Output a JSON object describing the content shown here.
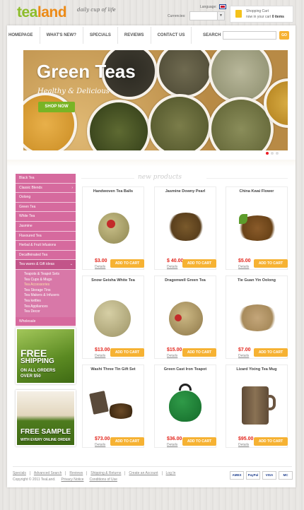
{
  "header": {
    "logo_tea": "tea",
    "logo_land": "land",
    "tagline": "daily cup of life",
    "language_label": "Language:",
    "currencies_label": "Currencies:",
    "currency_value": "",
    "cart_title": "Shopping Cart",
    "cart_status_prefix": "now in your cart",
    "cart_count": "0 items"
  },
  "nav": {
    "items": [
      "HOMEPAGE",
      "WHAT'S NEW?",
      "SPECIALS",
      "REVIEWS",
      "CONTACT US"
    ],
    "search_label": "SEARCH",
    "search_placeholder": "",
    "go_label": "GO"
  },
  "banner": {
    "headline": "Green Teas",
    "subhead": "Healthy & Delicious",
    "cta": "SHOP NOW"
  },
  "sidebar": {
    "categories": [
      {
        "label": "Black Tea"
      },
      {
        "label": "Classic Blends",
        "caret": "›"
      },
      {
        "label": "Oolong"
      },
      {
        "label": "Green Tea"
      },
      {
        "label": "White Tea"
      },
      {
        "label": "Jasmine"
      },
      {
        "label": "Flavoured Tea"
      },
      {
        "label": "Herbal & Fruit Infusions"
      },
      {
        "label": "Decaffeinated Tea"
      },
      {
        "label": "Tea wares & Gift ideas",
        "caret": "⌄"
      }
    ],
    "subcategories": [
      "Teapots & Teapot Sets",
      "Tea Cups & Mugs",
      "Tea Accessories",
      "Tea Storage Tins",
      "Tea Makers & Infusers",
      "Tea kettles",
      "Tea Appliances",
      "Tea Decor"
    ],
    "active_subcategory": "Tea Accessories",
    "last_category": "Wholesale"
  },
  "promos": {
    "shipping_big": "FREE",
    "shipping_big2": "SHIPPING",
    "shipping_small": "ON ALL ORDERS",
    "shipping_small2": "OVER $50",
    "sample_big": "FREE SAMPLE",
    "sample_small": "WITH EVERY ONLINE ORDER"
  },
  "products_title": "new products",
  "products": [
    {
      "name": "Handwoven Tea Balls",
      "price": "$3.00",
      "details": "Details",
      "add": "ADD TO CART"
    },
    {
      "name": "Jasmine Downy Pearl",
      "price": "$ 40.00",
      "details": "Details",
      "add": "ADD TO CART"
    },
    {
      "name": "China Kwai Flower",
      "price": "$5.00",
      "details": "Details",
      "add": "ADD TO CART"
    },
    {
      "name": "Snow Geisha White Tea",
      "price": "$13.00",
      "details": "Details",
      "add": "ADD TO CART"
    },
    {
      "name": "Dragonwell Green Tea",
      "price": "$15.00",
      "details": "Details",
      "add": "ADD TO CART"
    },
    {
      "name": "Tie Guan Yin Oolong",
      "price": "$7.00",
      "details": "Details",
      "add": "ADD TO CART"
    },
    {
      "name": "Washi Three Tin Gift Set",
      "price": "$73.00",
      "details": "Details",
      "add": "ADD TO CART"
    },
    {
      "name": "Green Cast Iron Teapot",
      "price": "$36.00",
      "details": "Details",
      "add": "ADD TO CART"
    },
    {
      "name": "Lizard Yixing Tea Mug",
      "price": "$95.00",
      "details": "Details",
      "add": "ADD TO CART"
    }
  ],
  "footer": {
    "links": [
      "Specials",
      "Advanced Search",
      "Reviews",
      "Shipping & Returns",
      "Create an Account",
      "Log In"
    ],
    "copyright": "Copyright © 2011 TeaLand.",
    "privacy": "Privacy Notice",
    "conditions": "Conditions of Use",
    "payment": [
      "AMEX",
      "PayPal",
      "VISA",
      "MC"
    ]
  },
  "colors": {
    "accent_orange": "#f6b233",
    "brand_green": "#8dbd2a",
    "brand_orange": "#ec8a16",
    "sidebar_pink": "#d66a9e",
    "price_red": "#e3241b"
  }
}
